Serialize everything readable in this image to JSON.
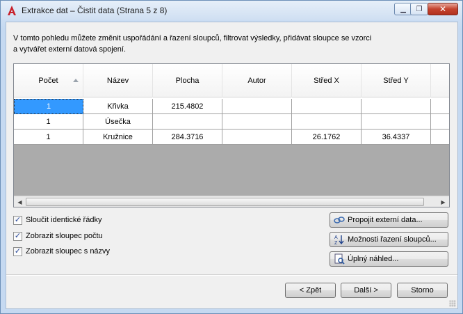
{
  "window": {
    "title": "Extrakce dat – Čistit data (Strana 5 z 8)",
    "close_glyph": "✕",
    "min_glyph": "▁",
    "max_glyph": "❐"
  },
  "description": "V tomto pohledu můžete změnit uspořádání a řazení sloupců, filtrovat výsledky, přidávat sloupce se vzorci a vytvářet externí datová spojení.",
  "table": {
    "columns": [
      "Počet",
      "Název",
      "Plocha",
      "Autor",
      "Střed X",
      "Střed Y"
    ],
    "sorted_column": "Počet",
    "sort_direction": "ascending",
    "rows": [
      {
        "count": "1",
        "name": "Křivka",
        "area": "215.4802",
        "author": "",
        "cx": "",
        "cy": ""
      },
      {
        "count": "1",
        "name": "Úsečka",
        "area": "",
        "author": "",
        "cx": "",
        "cy": ""
      },
      {
        "count": "1",
        "name": "Kružnice",
        "area": "284.3716",
        "author": "",
        "cx": "26.1762",
        "cy": "36.4337"
      }
    ],
    "selected_row": 0
  },
  "options": {
    "combine_identical_rows": {
      "label": "Sloučit identické řádky",
      "checked": true
    },
    "show_count_column": {
      "label": "Zobrazit sloupec počtu",
      "checked": true
    },
    "show_name_column": {
      "label": "Zobrazit sloupec s názvy",
      "checked": true
    }
  },
  "side_buttons": {
    "link_external": "Propojit externí data...",
    "sort_options": "Možnosti řazení sloupců...",
    "full_preview": "Úplný náhled..."
  },
  "footer": {
    "back": "< Zpět",
    "next": "Další >",
    "cancel": "Storno"
  },
  "colors": {
    "selection": "#3399ff",
    "empty_grid_area": "#ababab",
    "app_icon": "#c8202a"
  }
}
